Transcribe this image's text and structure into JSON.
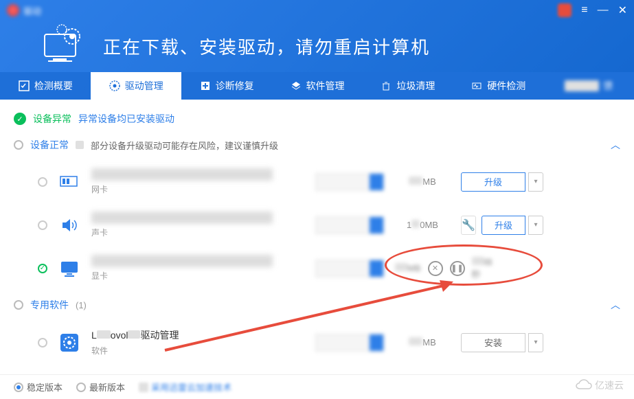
{
  "header": {
    "logo_text": "驱动",
    "title": "正在下载、安装驱动，请勿重启计算机"
  },
  "tabs": [
    {
      "id": "overview",
      "label": "检测概要"
    },
    {
      "id": "driver",
      "label": "驱动管理"
    },
    {
      "id": "diagnose",
      "label": "诊断修复"
    },
    {
      "id": "software",
      "label": "软件管理"
    },
    {
      "id": "cleanup",
      "label": "垃圾清理"
    },
    {
      "id": "hardware",
      "label": "硬件检测"
    },
    {
      "id": "more",
      "label": "馈"
    }
  ],
  "status": {
    "abnormal_label": "设备异常",
    "abnormal_desc": "异常设备均已安装驱动"
  },
  "sections": {
    "normal": {
      "title": "设备正常",
      "desc": "部分设备升级驱动可能存在风险，建议谨慎升级"
    },
    "special": {
      "title": "专用软件",
      "count": "(1)"
    }
  },
  "devices": [
    {
      "type": "网卡",
      "size_suffix": "MB",
      "action": "升级",
      "icon": "network"
    },
    {
      "type": "声卡",
      "size_prefix": "1",
      "size_suffix": "0MB",
      "action": "升级",
      "icon": "audio",
      "has_wrench": true
    },
    {
      "type": "显卡",
      "size_suffix": "MB",
      "speed_suffix": "秒",
      "icon": "display",
      "downloading": true,
      "checked": true
    }
  ],
  "software": [
    {
      "name_prefix": "L",
      "name_mid": "ovol",
      "name_suffix": "驱动管理",
      "type": "软件",
      "size_suffix": "MB",
      "action": "安装"
    }
  ],
  "footer": {
    "stable": "稳定版本",
    "latest": "最新版本",
    "tech": "采用迅雷云加速技术"
  },
  "watermark": "亿速云"
}
